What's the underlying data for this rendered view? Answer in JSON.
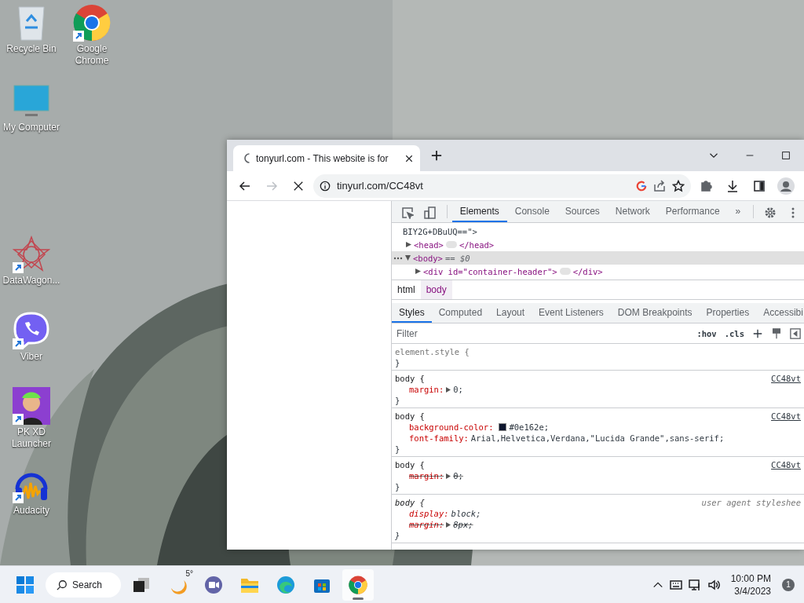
{
  "desktop_icons": [
    {
      "label": "Recycle Bin",
      "kind": "recycle",
      "shortcut": false
    },
    {
      "label": "Google Chrome",
      "kind": "chrome",
      "shortcut": true
    },
    {
      "label": "My Computer",
      "kind": "monitor",
      "shortcut": false
    },
    {
      "label": "DataWagon...",
      "kind": "star",
      "shortcut": true
    },
    {
      "label": "Viber",
      "kind": "viber",
      "shortcut": true
    },
    {
      "label": "PK XD Launcher",
      "kind": "avatar",
      "shortcut": true
    },
    {
      "label": "Audacity",
      "kind": "audacity",
      "shortcut": true
    }
  ],
  "browser": {
    "tab": {
      "title": "tonyurl.com - This website is for",
      "loading": true
    },
    "address": "tinyurl.com/CC48vt",
    "devtools": {
      "tabs": [
        {
          "label": "Elements",
          "selected": true
        },
        {
          "label": "Console",
          "selected": false
        },
        {
          "label": "Sources",
          "selected": false
        },
        {
          "label": "Network",
          "selected": false
        },
        {
          "label": "Performance",
          "selected": false
        }
      ],
      "more": "»",
      "dom_lines": [
        {
          "kind": "text",
          "text": "BIY2G+DBuUQ==\">",
          "selected": false
        },
        {
          "kind": "node",
          "open": "<head>",
          "close": "</head>",
          "expanded": false,
          "selected": false
        },
        {
          "kind": "node",
          "open": "<body>",
          "note": "== $0",
          "expanded": true,
          "selected": true
        },
        {
          "kind": "child",
          "open": "<div id=\"container-header\">",
          "close": "</div>",
          "expanded": false,
          "selected": false
        }
      ],
      "breadcrumbs": [
        {
          "label": "html",
          "selected": false
        },
        {
          "label": "body",
          "selected": true
        }
      ],
      "style_tabs": [
        {
          "label": "Styles",
          "selected": true
        },
        {
          "label": "Computed",
          "selected": false
        },
        {
          "label": "Layout",
          "selected": false
        },
        {
          "label": "Event Listeners",
          "selected": false
        },
        {
          "label": "DOM Breakpoints",
          "selected": false
        },
        {
          "label": "Properties",
          "selected": false
        },
        {
          "label": "Accessibi",
          "selected": false
        }
      ],
      "filter": {
        "placeholder": "Filter",
        "hov": ":hov",
        "cls": ".cls"
      },
      "rules": [
        {
          "kind": "inline",
          "selector": "element.style {",
          "close": "}"
        },
        {
          "kind": "author",
          "selector": "body {",
          "source": "CC48vt",
          "close": "}",
          "declarations": [
            {
              "property": "margin:",
              "value": "0;",
              "expandable": true,
              "overridden": false
            }
          ]
        },
        {
          "kind": "author",
          "selector": "body {",
          "source": "CC48vt",
          "close": "}",
          "declarations": [
            {
              "property": "background-color:",
              "value": "#0e162e;",
              "swatch": true,
              "overridden": false
            },
            {
              "property": "font-family:",
              "value": "Arial,Helvetica,Verdana,\"Lucida Grande\",sans-serif;",
              "overridden": false
            }
          ]
        },
        {
          "kind": "author",
          "selector": "body {",
          "source": "CC48vt",
          "close": "}",
          "declarations": [
            {
              "property": "margin:",
              "value": "0;",
              "expandable": true,
              "overridden": true
            }
          ]
        },
        {
          "kind": "user_agent",
          "selector": "body {",
          "source": "user agent styleshee",
          "close": "}",
          "declarations": [
            {
              "property": "display:",
              "value": "block;",
              "overridden": false
            },
            {
              "property": "margin:",
              "value": "8px;",
              "expandable": true,
              "overridden": true
            }
          ]
        }
      ]
    }
  },
  "taskbar": {
    "search": "Search",
    "weather": "5°",
    "apps": [
      {
        "kind": "meet",
        "active": false
      },
      {
        "kind": "explorer",
        "active": false
      },
      {
        "kind": "edge",
        "active": false
      },
      {
        "kind": "store",
        "active": false
      },
      {
        "kind": "chrome",
        "active": true
      }
    ],
    "time": "10:00 PM",
    "date": "3/4/2023",
    "notifications": "1"
  }
}
